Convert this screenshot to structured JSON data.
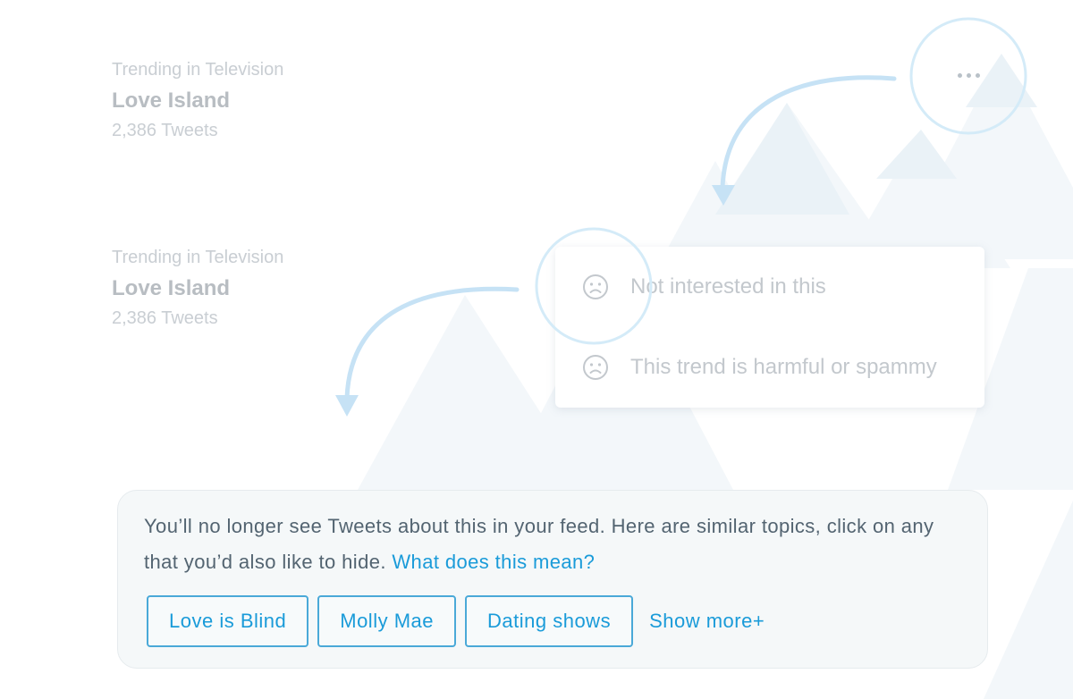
{
  "trends": [
    {
      "context": "Trending in Television",
      "title": "Love Island",
      "count": "2,386 Tweets"
    },
    {
      "context": "Trending in Television",
      "title": "Love Island",
      "count": "2,386 Tweets"
    }
  ],
  "more_button": {
    "icon": "more-dots-icon"
  },
  "menu": {
    "items": [
      {
        "icon": "sad-face-icon",
        "label": "Not interested in this"
      },
      {
        "icon": "sad-face-icon",
        "label": "This trend is harmful or spammy"
      }
    ]
  },
  "notice": {
    "message": "You’ll no longer see Tweets about this in your feed. Here are similar topics, click on any that you’d also like to hide.",
    "link": "What does this mean?",
    "topics": [
      "Love is Blind",
      "Molly Mae",
      "Dating shows"
    ],
    "show_more": "Show more+"
  },
  "colors": {
    "accent": "#1a9bd9",
    "annotation": "#cde6f6",
    "mountain": "#edf4f8"
  }
}
